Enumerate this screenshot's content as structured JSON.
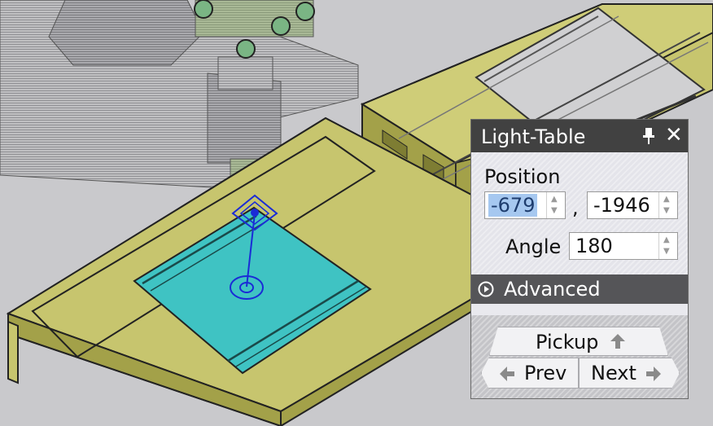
{
  "panel": {
    "title": "Light-Table",
    "pin_icon": "pin-icon",
    "close_glyph": "✕",
    "position_label": "Position",
    "position_x": "-679",
    "position_separator": ",",
    "position_y": "-1946",
    "angle_label": "Angle",
    "angle_value": "180",
    "advanced_label": "Advanced",
    "advanced_icon": "play-circle-icon",
    "pickup_label": "Pickup",
    "prev_label": "Prev",
    "next_label": "Next"
  },
  "colors": {
    "machine_bed": "#c7c56e",
    "sheet": "#3fc3c3",
    "gizmo": "#1a2bd6",
    "panel_title": "#414141",
    "advanced_bar": "#555558"
  }
}
